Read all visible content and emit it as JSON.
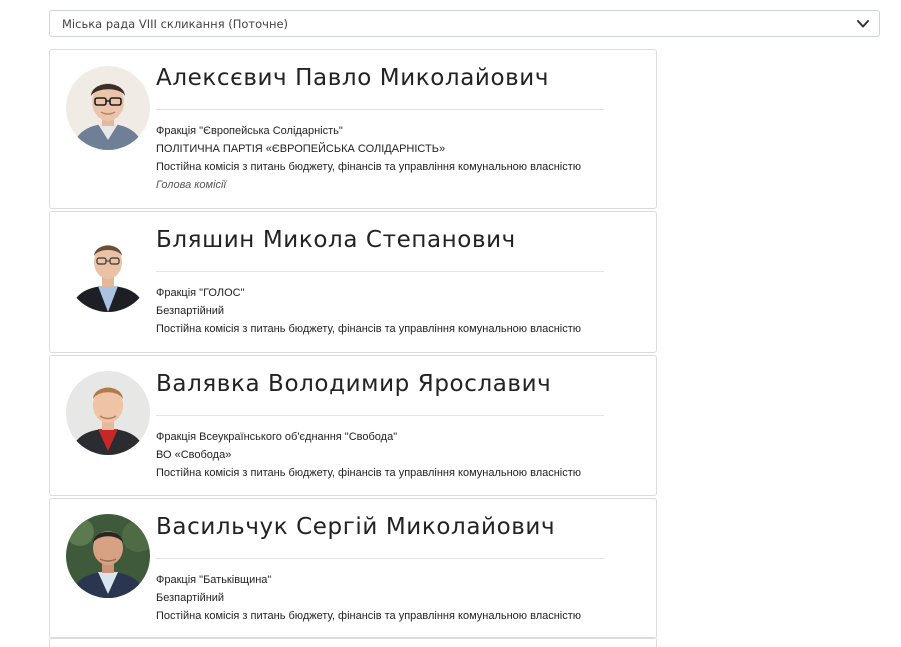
{
  "convocation_select": {
    "value": "Міська рада VIII скликання (Поточне)",
    "icon": "chevron-down-icon"
  },
  "deputies": [
    {
      "name": "Алексєвич Павло Миколайович",
      "faction": "Фракція \"Європейська Солідарність\"",
      "party": "ПОЛІТИЧНА ПАРТІЯ «ЄВРОПЕЙСЬКА СОЛІДАРНІСТЬ»",
      "commission": "Постійна комісія з питань бюджету, фінансів та управління комунальною власністю",
      "role": "Голова комісії"
    },
    {
      "name": "Бляшин Микола Степанович",
      "faction": "Фракція \"ГОЛОС\"",
      "party": "Безпартійний",
      "commission": "Постійна комісія з питань бюджету, фінансів та управління комунальною власністю"
    },
    {
      "name": "Валявка Володимир Ярославич",
      "faction": "Фракція Всеукраїнського об'єднання \"Свобода\"",
      "party": "ВО «Свобода»",
      "commission": "Постійна комісія з питань бюджету, фінансів та управління комунальною власністю"
    },
    {
      "name": "Васильчук Сергій Миколайович",
      "faction": "Фракція \"Батьківщина\"",
      "party": "Безпартійний",
      "commission": "Постійна комісія з питань бюджету, фінансів та управління комунальною власністю"
    }
  ]
}
